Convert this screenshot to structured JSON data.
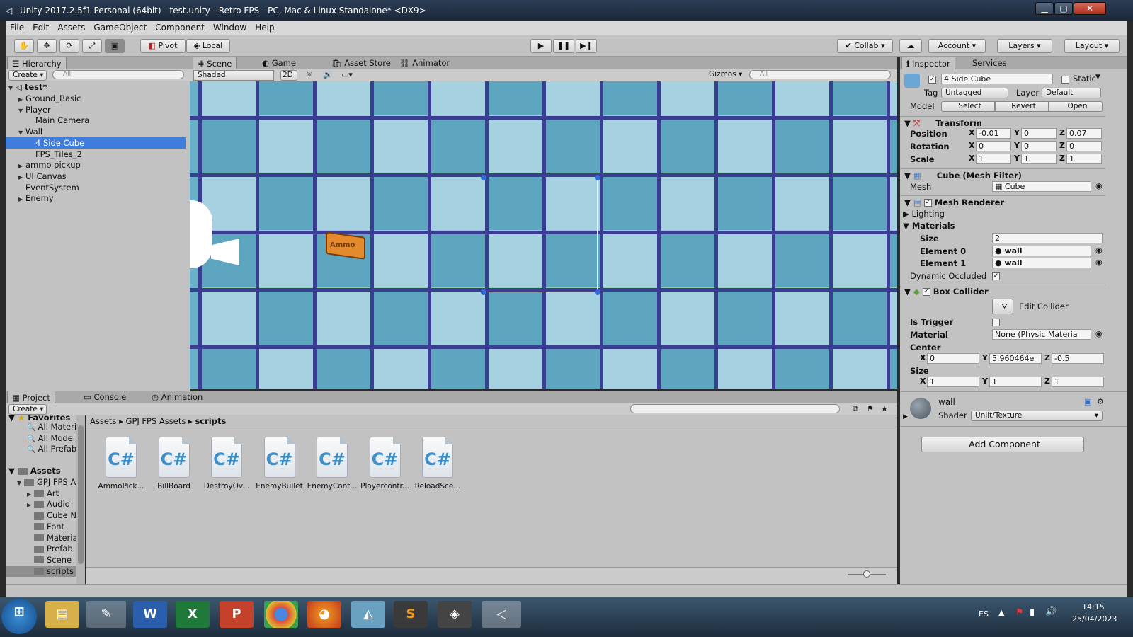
{
  "window": {
    "title": "Unity 2017.2.5f1 Personal (64bit) - test.unity - Retro FPS - PC, Mac & Linux Standalone* <DX9>"
  },
  "menu": [
    "File",
    "Edit",
    "Assets",
    "GameObject",
    "Component",
    "Window",
    "Help"
  ],
  "toolbar": {
    "pivot": "Pivot",
    "local": "Local",
    "collab": "Collab",
    "account": "Account",
    "layers": "Layers",
    "layout": "Layout"
  },
  "hierarchy": {
    "tab": "Hierarchy",
    "create": "Create",
    "search_placeholder": "All",
    "scene": "test*",
    "items": [
      {
        "label": "Ground_Basic",
        "depth": 1,
        "arrow": "right"
      },
      {
        "label": "Player",
        "depth": 1,
        "arrow": "down"
      },
      {
        "label": "Main Camera",
        "depth": 2,
        "arrow": ""
      },
      {
        "label": "Wall",
        "depth": 1,
        "arrow": "down"
      },
      {
        "label": "4 Side Cube",
        "depth": 2,
        "arrow": "",
        "selected": true
      },
      {
        "label": "FPS_Tiles_2",
        "depth": 2,
        "arrow": ""
      },
      {
        "label": "ammo pickup",
        "depth": 1,
        "arrow": "right"
      },
      {
        "label": "UI Canvas",
        "depth": 1,
        "arrow": "right"
      },
      {
        "label": "EventSystem",
        "depth": 1,
        "arrow": ""
      },
      {
        "label": "Enemy",
        "depth": 1,
        "arrow": "right"
      }
    ]
  },
  "scene_tabs": {
    "scene": "Scene",
    "game": "Game",
    "asset_store": "Asset Store",
    "animator": "Animator"
  },
  "scene_bar": {
    "shading": "Shaded",
    "mode2d": "2D",
    "gizmos": "Gizmos",
    "search_placeholder": "All"
  },
  "scene_view": {
    "ammo_label": "Ammo"
  },
  "inspector": {
    "tab": "Inspector",
    "services_tab": "Services",
    "object_name": "4 Side Cube",
    "static_label": "Static",
    "tag_label": "Tag",
    "tag": "Untagged",
    "layer_label": "Layer",
    "layer": "Default",
    "model_label": "Model",
    "select": "Select",
    "revert": "Revert",
    "open": "Open",
    "transform": {
      "title": "Transform",
      "position_label": "Position",
      "position": [
        "-0.01",
        "0",
        "0.07"
      ],
      "rotation_label": "Rotation",
      "rotation": [
        "0",
        "0",
        "0"
      ],
      "scale_label": "Scale",
      "scale": [
        "1",
        "1",
        "1"
      ]
    },
    "mesh_filter": {
      "title": "Cube (Mesh Filter)",
      "mesh_label": "Mesh",
      "mesh": "Cube"
    },
    "mesh_renderer": {
      "title": "Mesh Renderer",
      "lighting": "Lighting",
      "materials": "Materials",
      "size_label": "Size",
      "size": "2",
      "element0_label": "Element 0",
      "element0": "wall",
      "element1_label": "Element 1",
      "element1": "wall",
      "dynamic_occluded": "Dynamic Occluded"
    },
    "box_collider": {
      "title": "Box Collider",
      "edit_collider": "Edit Collider",
      "is_trigger": "Is Trigger",
      "material_label": "Material",
      "material": "None (Physic Materia",
      "center_label": "Center",
      "center": [
        "0",
        "5.960464e",
        "-0.5"
      ],
      "size_label": "Size",
      "size": [
        "1",
        "1",
        "1"
      ]
    },
    "material": {
      "name": "wall",
      "shader_label": "Shader",
      "shader": "Unlit/Texture"
    },
    "add_component": "Add Component",
    "axis": [
      "X",
      "Y",
      "Z"
    ]
  },
  "project": {
    "tab": "Project",
    "console_tab": "Console",
    "animation_tab": "Animation",
    "create": "Create",
    "favorites": "Favorites",
    "fav_items": [
      "All Materi",
      "All Model",
      "All Prefab"
    ],
    "assets_root": "Assets",
    "tree": [
      {
        "label": "GPJ FPS A",
        "depth": 1,
        "arrow": "down"
      },
      {
        "label": "Art",
        "depth": 2,
        "arrow": "right"
      },
      {
        "label": "Audio",
        "depth": 2,
        "arrow": "right"
      },
      {
        "label": "Cube N",
        "depth": 2,
        "arrow": ""
      },
      {
        "label": "Font",
        "depth": 2,
        "arrow": ""
      },
      {
        "label": "Materia",
        "depth": 2,
        "arrow": ""
      },
      {
        "label": "Prefab",
        "depth": 2,
        "arrow": ""
      },
      {
        "label": "Scene",
        "depth": 2,
        "arrow": ""
      },
      {
        "label": "scripts",
        "depth": 2,
        "arrow": "",
        "selected": true
      }
    ],
    "breadcrumb": [
      "Assets",
      "GPJ FPS Assets",
      "scripts"
    ],
    "files": [
      "AmmoPick...",
      "BillBoard",
      "DestroyOv...",
      "EnemyBullet",
      "EnemyCont...",
      "Playercontr...",
      "ReloadSce..."
    ],
    "file_icon": "C#"
  },
  "taskbar": {
    "lang": "ES",
    "time": "14:15",
    "date": "25/04/2023"
  },
  "colors": {
    "selection": "#3e7ddd",
    "panel": "#c2c2c2",
    "grid_line": "#3a3e92",
    "tile_dark": "#5ea6bf",
    "tile_light": "#a5d1e0"
  }
}
